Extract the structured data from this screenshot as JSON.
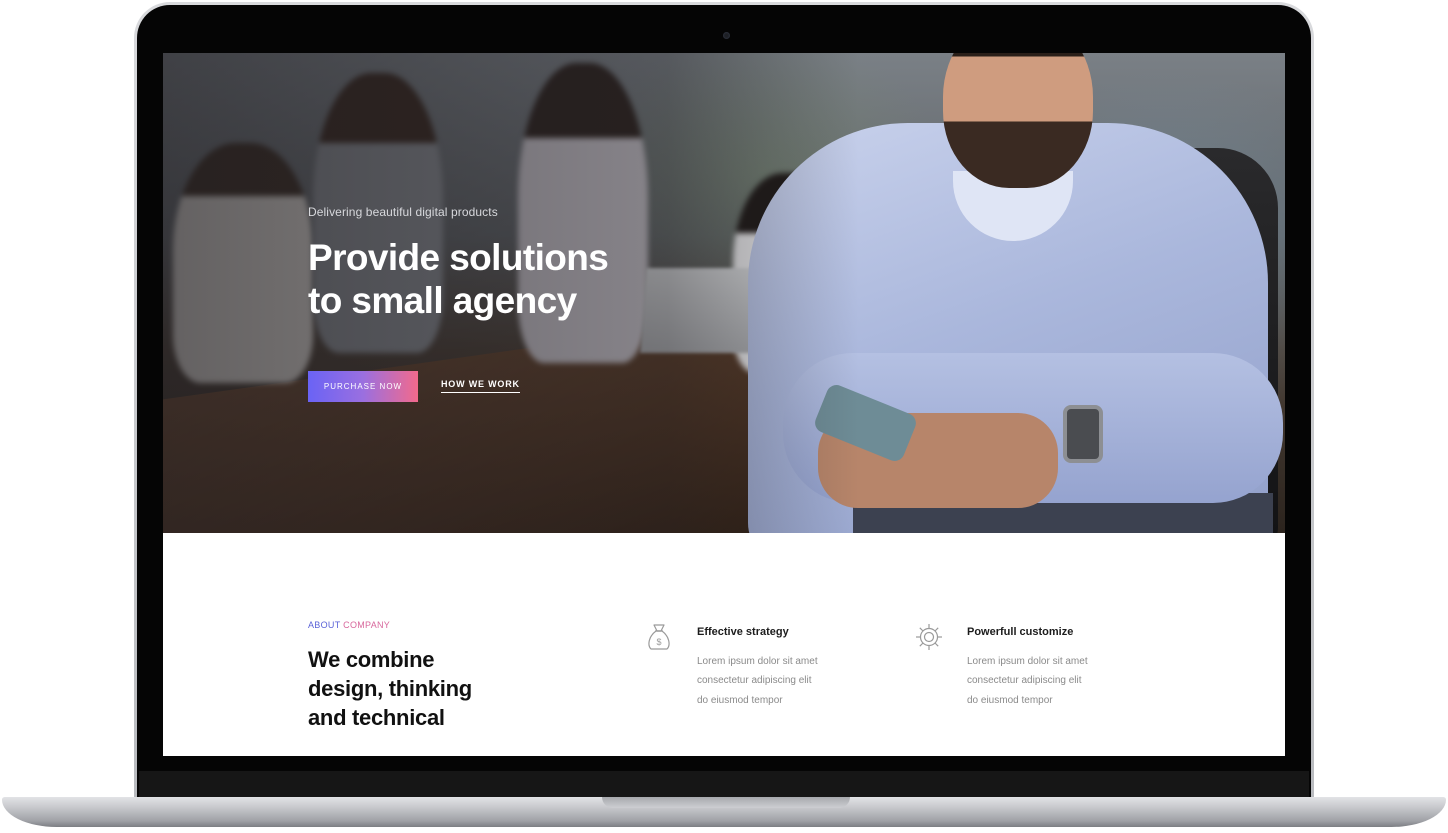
{
  "hero": {
    "eyebrow": "Delivering beautiful digital products",
    "title_line1": "Provide solutions",
    "title_line2": "to small agency",
    "primary_button": "PURCHASE NOW",
    "secondary_link": "HOW WE WORK"
  },
  "about": {
    "label_part1": "ABOUT",
    "label_part2": "COMPANY",
    "heading_line1": "We combine",
    "heading_line2": "design, thinking",
    "heading_line3": "and technical",
    "features": [
      {
        "icon": "money-bag-icon",
        "title": "Effective strategy",
        "desc_lines": [
          "Lorem ipsum dolor sit amet",
          "consectetur adipiscing elit",
          "do eiusmod tempor"
        ]
      },
      {
        "icon": "gear-icon",
        "title": "Powerfull customize",
        "desc_lines": [
          "Lorem ipsum dolor sit amet",
          "consectetur adipiscing elit",
          "do eiusmod tempor"
        ]
      }
    ]
  },
  "colors": {
    "button_gradient_start": "#6a63f5",
    "button_gradient_end": "#f26a8c",
    "label_blue": "#5b63d8",
    "label_pink": "#d8679c",
    "heading_text": "#111111",
    "body_text": "#8a8a8a"
  }
}
